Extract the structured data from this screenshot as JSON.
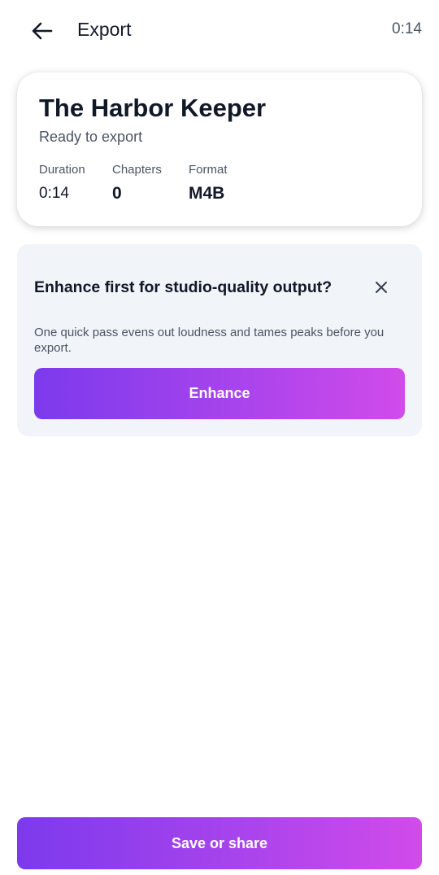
{
  "header": {
    "back_icon": "arrow-left-icon",
    "title": "Export",
    "time": "0:14"
  },
  "project": {
    "title": "The Harbor Keeper",
    "status": "Ready to export",
    "stats": {
      "duration_label": "Duration",
      "duration_value": "0:14",
      "chapters_label": "Chapters",
      "chapters_value": "0",
      "format_label": "Format",
      "format_value": "M4B"
    }
  },
  "enhance": {
    "title": "Enhance first for studio-quality output?",
    "close_icon": "close-icon",
    "description": "One quick pass evens out loudness and tames peaks before you export.",
    "button_label": "Enhance"
  },
  "footer": {
    "save_label": "Save or share"
  },
  "colors": {
    "gradient_start": "#7c3aed",
    "gradient_end": "#d14bea",
    "enhance_card_bg": "#f1f4f8",
    "text_primary": "#111827",
    "text_secondary": "#4b5563"
  }
}
